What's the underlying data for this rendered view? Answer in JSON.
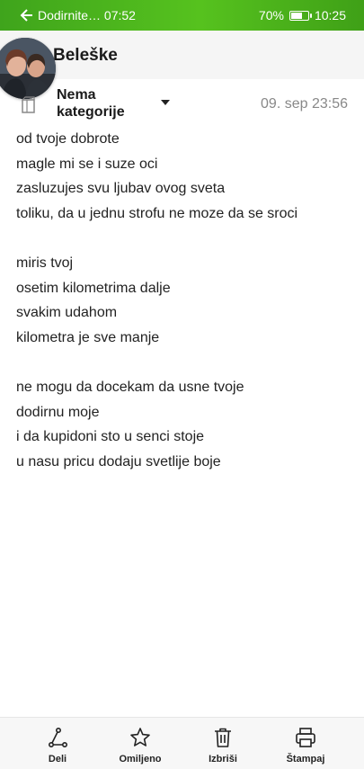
{
  "status_bar": {
    "notification": "Dodirnite… 07:52",
    "battery_percent": "70%",
    "battery_level": 0.7,
    "time": "10:25"
  },
  "app_bar": {
    "title": "Beleške"
  },
  "note": {
    "category": "Nema kategorije",
    "date": "09. sep 23:56",
    "lines": [
      "od tvoje dobrote",
      "magle mi se i suze oci",
      "zasluzujes svu ljubav ovog sveta",
      "toliku, da u jednu strofu ne moze da se sroci",
      "",
      "miris tvoj",
      "osetim kilometrima dalje",
      "svakim udahom",
      "kilometra je sve manje",
      "",
      "ne mogu da docekam da usne tvoje",
      "dodirnu moje",
      "i da kupidoni sto u senci stoje",
      "u nasu pricu dodaju svetlije boje"
    ]
  },
  "toolbar": {
    "share_label": "Deli",
    "favorite_label": "Omiljeno",
    "delete_label": "Izbriši",
    "print_label": "Štampaj"
  },
  "icons": {
    "back": "arrow-left-icon",
    "category": "folder-icon",
    "share": "share-icon",
    "favorite": "star-icon",
    "delete": "trash-icon",
    "print": "printer-icon"
  },
  "colors": {
    "status_bar": "#4db51e",
    "app_bar": "#f5f5f5",
    "date_text": "#888888"
  }
}
